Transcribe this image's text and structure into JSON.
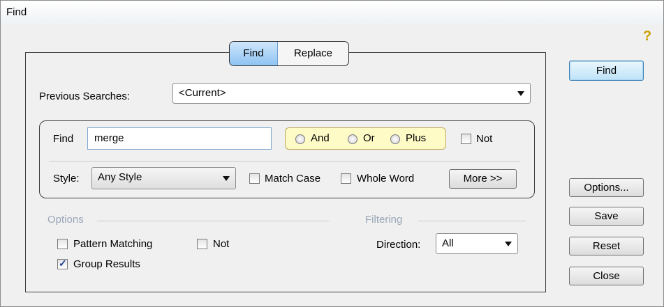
{
  "window": {
    "title": "Find"
  },
  "tabs": [
    {
      "label": "Find"
    },
    {
      "label": "Replace"
    }
  ],
  "previous_searches": {
    "label": "Previous Searches:",
    "value": "<Current>"
  },
  "find": {
    "label": "Find",
    "value": "merge"
  },
  "logic": {
    "and": "And",
    "or": "Or",
    "plus": "Plus",
    "not": "Not"
  },
  "style": {
    "label": "Style:",
    "value": "Any Style"
  },
  "match_case": {
    "label": "Match Case",
    "checked": false
  },
  "whole_word": {
    "label": "Whole Word",
    "checked": false
  },
  "more_button": "More >>",
  "options": {
    "title": "Options",
    "pattern_matching": {
      "label": "Pattern Matching",
      "checked": false
    },
    "not": {
      "label": "Not",
      "checked": false
    },
    "group_results": {
      "label": "Group Results",
      "checked": true
    }
  },
  "filtering": {
    "title": "Filtering",
    "direction_label": "Direction:",
    "direction_value": "All"
  },
  "buttons": {
    "find": "Find",
    "options": "Options...",
    "save": "Save",
    "reset": "Reset",
    "close": "Close"
  },
  "icons": {
    "help": "help-icon"
  },
  "colors": {
    "tab_active": "#8ec4f3",
    "logic_box": "#fffbc7",
    "primary_button_border": "#3c7fb1"
  }
}
